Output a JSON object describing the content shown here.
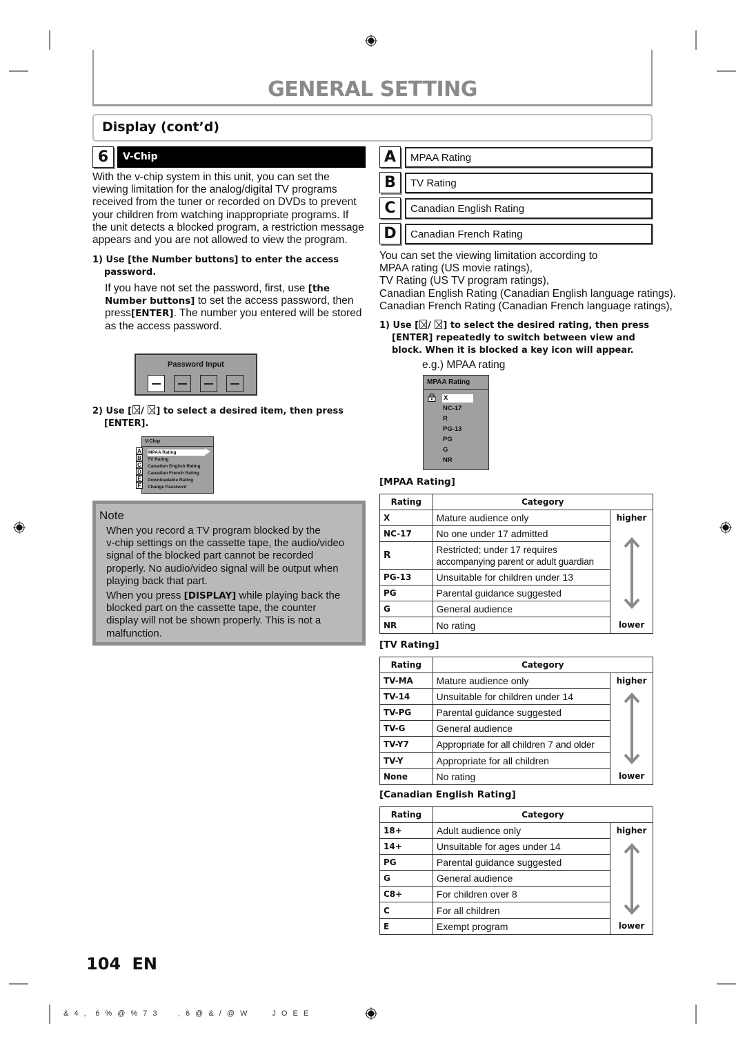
{
  "header": {
    "title": "GENERAL SETTING",
    "section": "Display (cont’d)"
  },
  "step": {
    "number": "6",
    "title": "V-Chip",
    "intro": [
      "With the v-chip system in this unit, you can set the",
      "viewing limitation for the analog/digital TV programs",
      "received from the tuner or recorded on DVDs to prevent",
      "your children from watching inappropriate programs. If",
      "the unit detects a blocked program, a restriction message",
      "appears and you are not allowed to view the program."
    ],
    "instr1": {
      "line1": "1) Use [the Number buttons] to enter the access",
      "line2": "password.",
      "detail_a": "If you have not set the password, first, use ",
      "detail_a_bold": "[the",
      "detail_b_bold": "Number buttons]",
      "detail_b": " to set the access password, then",
      "detail_c": "press",
      "detail_c_bold": "[ENTER]",
      "detail_c2": ". The number you entered will be stored",
      "detail_d": "as the access password."
    },
    "password_box": {
      "title": "Password Input",
      "slots": 4,
      "active_slot": 1
    },
    "instr2": {
      "prefix": "2) Use [",
      "sep": "/ ",
      "suffix": "] to select a desired item, then press",
      "line2": "[ENTER]."
    },
    "vchip_menu": {
      "title": "V-Chip",
      "items": [
        {
          "letter": "A",
          "label": "MPAA Rating",
          "selected": true
        },
        {
          "letter": "B",
          "label": "TV Rating",
          "selected": false
        },
        {
          "letter": "C",
          "label": "Canadian English Rating",
          "selected": false
        },
        {
          "letter": "D",
          "label": "Canadian French Rating",
          "selected": false
        },
        {
          "letter": "E",
          "label": "Downloadable Rating",
          "selected": false
        },
        {
          "letter": "F",
          "label": "Change Password",
          "selected": false
        }
      ]
    }
  },
  "note": {
    "title": "Note",
    "para1": [
      "When you record a TV program blocked by the",
      "v-chip settings on the cassette tape, the audio/video",
      "signal of the blocked part cannot be recorded",
      "properly. No audio/video signal will be output when",
      "playing back that part."
    ],
    "para2_a": "When you press ",
    "para2_bold": "[DISPLAY]",
    "para2_b": " while playing back the",
    "para2_rest": [
      "blocked part on the cassette tape, the counter",
      "display will not be shown properly. This is not a",
      "malfunction."
    ]
  },
  "categories": [
    {
      "letter": "A",
      "label": "MPAA Rating"
    },
    {
      "letter": "B",
      "label": "TV Rating"
    },
    {
      "letter": "C",
      "label": "Canadian English Rating"
    },
    {
      "letter": "D",
      "label": "Canadian French Rating"
    }
  ],
  "right_intro": [
    "You can set the viewing limitation according to",
    "MPAA rating (US movie ratings),",
    "TV Rating (US TV program ratings),",
    "Canadian English Rating (Canadian English language ratings).",
    "Canadian French Rating (Canadian French language ratings),"
  ],
  "right_instr": {
    "prefix": "1) Use [",
    "sep": "/ ",
    "suffix": "] to select the desired rating, then press",
    "line2": "[ENTER] repeatedly to switch between view and",
    "line3": "block. When it is blocked a key icon will appear.",
    "example": "e.g.) MPAA rating"
  },
  "mpaa_osd": {
    "title": "MPAA Rating",
    "items": [
      "X",
      "NC-17",
      "R",
      "PG-13",
      "PG",
      "G",
      "NR"
    ],
    "selected": "X",
    "locked": "X"
  },
  "tables": {
    "header_rating": "Rating",
    "header_category": "Category",
    "higher": "higher",
    "lower": "lower",
    "mpaa": {
      "title": "[MPAA Rating]",
      "rows": [
        {
          "rating": "X",
          "category": "Mature audience only"
        },
        {
          "rating": "NC-17",
          "category": "No one under 17 admitted"
        },
        {
          "rating": "R",
          "category": "Restricted; under 17 requires",
          "category2": "accompanying parent or adult guardian"
        },
        {
          "rating": "PG-13",
          "category": "Unsuitable for children under 13"
        },
        {
          "rating": "PG",
          "category": "Parental guidance suggested"
        },
        {
          "rating": "G",
          "category": "General audience"
        },
        {
          "rating": "NR",
          "category": "No rating"
        }
      ]
    },
    "tv": {
      "title": "[TV Rating]",
      "rows": [
        {
          "rating": "TV-MA",
          "category": "Mature audience only"
        },
        {
          "rating": "TV-14",
          "category": "Unsuitable for children under 14"
        },
        {
          "rating": "TV-PG",
          "category": "Parental guidance suggested"
        },
        {
          "rating": "TV-G",
          "category": "General audience"
        },
        {
          "rating": "TV-Y7",
          "category": "Appropriate for all children 7 and older"
        },
        {
          "rating": "TV-Y",
          "category": "Appropriate for all children"
        },
        {
          "rating": "None",
          "category": "No rating"
        }
      ]
    },
    "ce": {
      "title": "[Canadian English Rating]",
      "rows": [
        {
          "rating": "18+",
          "category": "Adult audience only"
        },
        {
          "rating": "14+",
          "category": "Unsuitable for ages under 14"
        },
        {
          "rating": "PG",
          "category": "Parental guidance suggested"
        },
        {
          "rating": "G",
          "category": "General audience"
        },
        {
          "rating": "C8+",
          "category": "For children over 8"
        },
        {
          "rating": "C",
          "category": "For all children"
        },
        {
          "rating": "E",
          "category": "Exempt program"
        }
      ]
    }
  },
  "footer": {
    "page": "104  EN",
    "code": "& 4 ,  6 % @ % 7 3     , 6 @ & / @ W      J O E E"
  }
}
